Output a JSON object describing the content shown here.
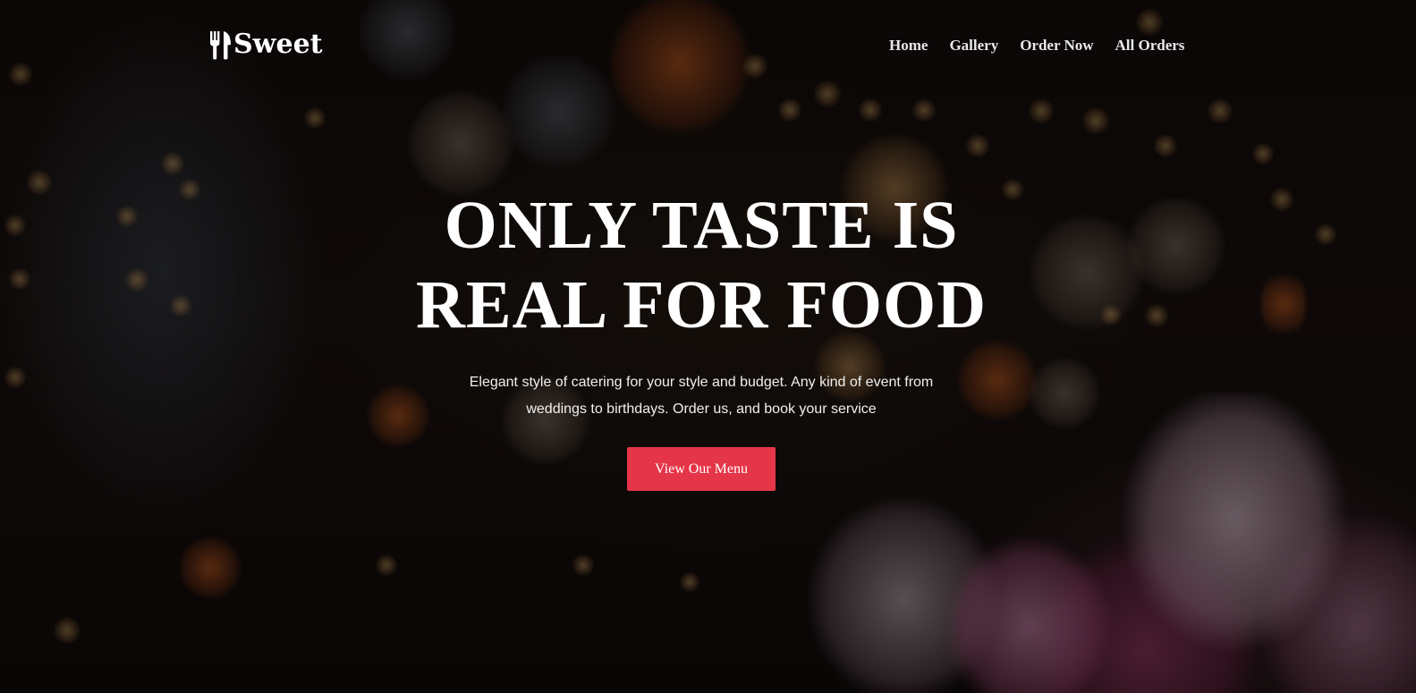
{
  "brand": {
    "logo_text": "Sweet",
    "logo_icon": "fork-knife-icon"
  },
  "nav": {
    "items": [
      {
        "label": "Home"
      },
      {
        "label": "Gallery"
      },
      {
        "label": "Order Now"
      },
      {
        "label": "All Orders"
      }
    ]
  },
  "hero": {
    "headline_line1": "ONLY TASTE IS",
    "headline_line2": "REAL FOR FOOD",
    "subtitle": "Elegant style of catering for your style and budget. Any kind of event from weddings to birthdays. Order us, and book your service",
    "cta_label": "View Our Menu"
  },
  "colors": {
    "accent": "#e53548",
    "text": "#ffffff",
    "overlay": "rgba(0,0,0,0.45)"
  }
}
